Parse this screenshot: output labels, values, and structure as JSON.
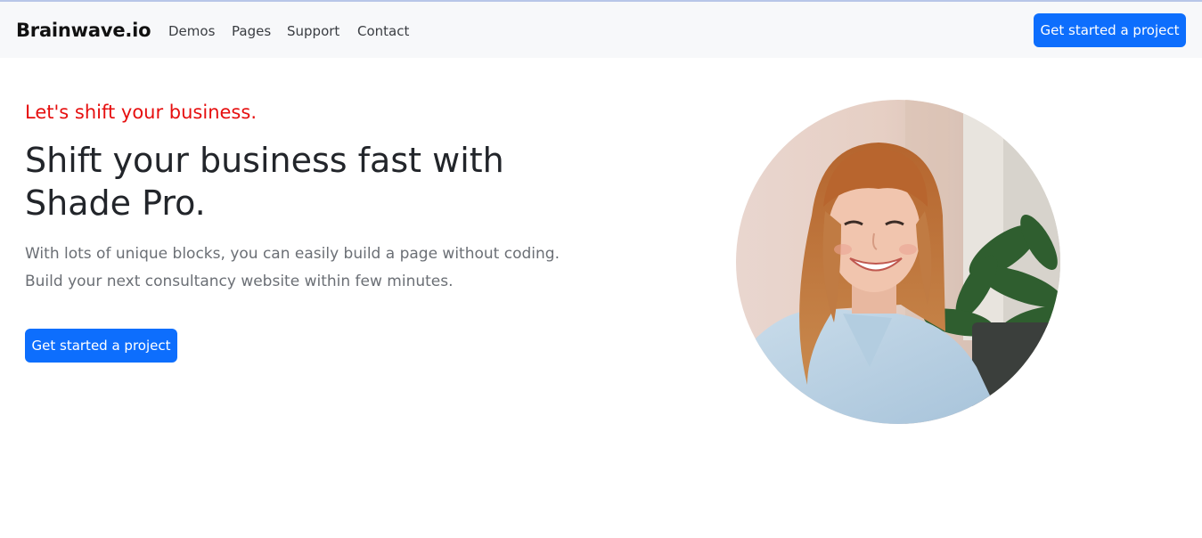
{
  "navbar": {
    "brand": "Brainwave.io",
    "links": [
      "Demos",
      "Pages",
      "Support",
      "Contact"
    ],
    "cta_label": "Get started a project"
  },
  "hero": {
    "tagline": "Let's shift your business.",
    "headline": "Shift your business fast with Shade Pro.",
    "lead": "With lots of unique blocks, you can easily build a page without coding. Build your next consultancy website within few minutes.",
    "cta_label": "Get started a project",
    "image": "smiling-woman-portrait"
  },
  "colors": {
    "primary": "#0d6efd",
    "tagline": "#e60f0f",
    "navbar_bg": "#f7f8fa"
  }
}
